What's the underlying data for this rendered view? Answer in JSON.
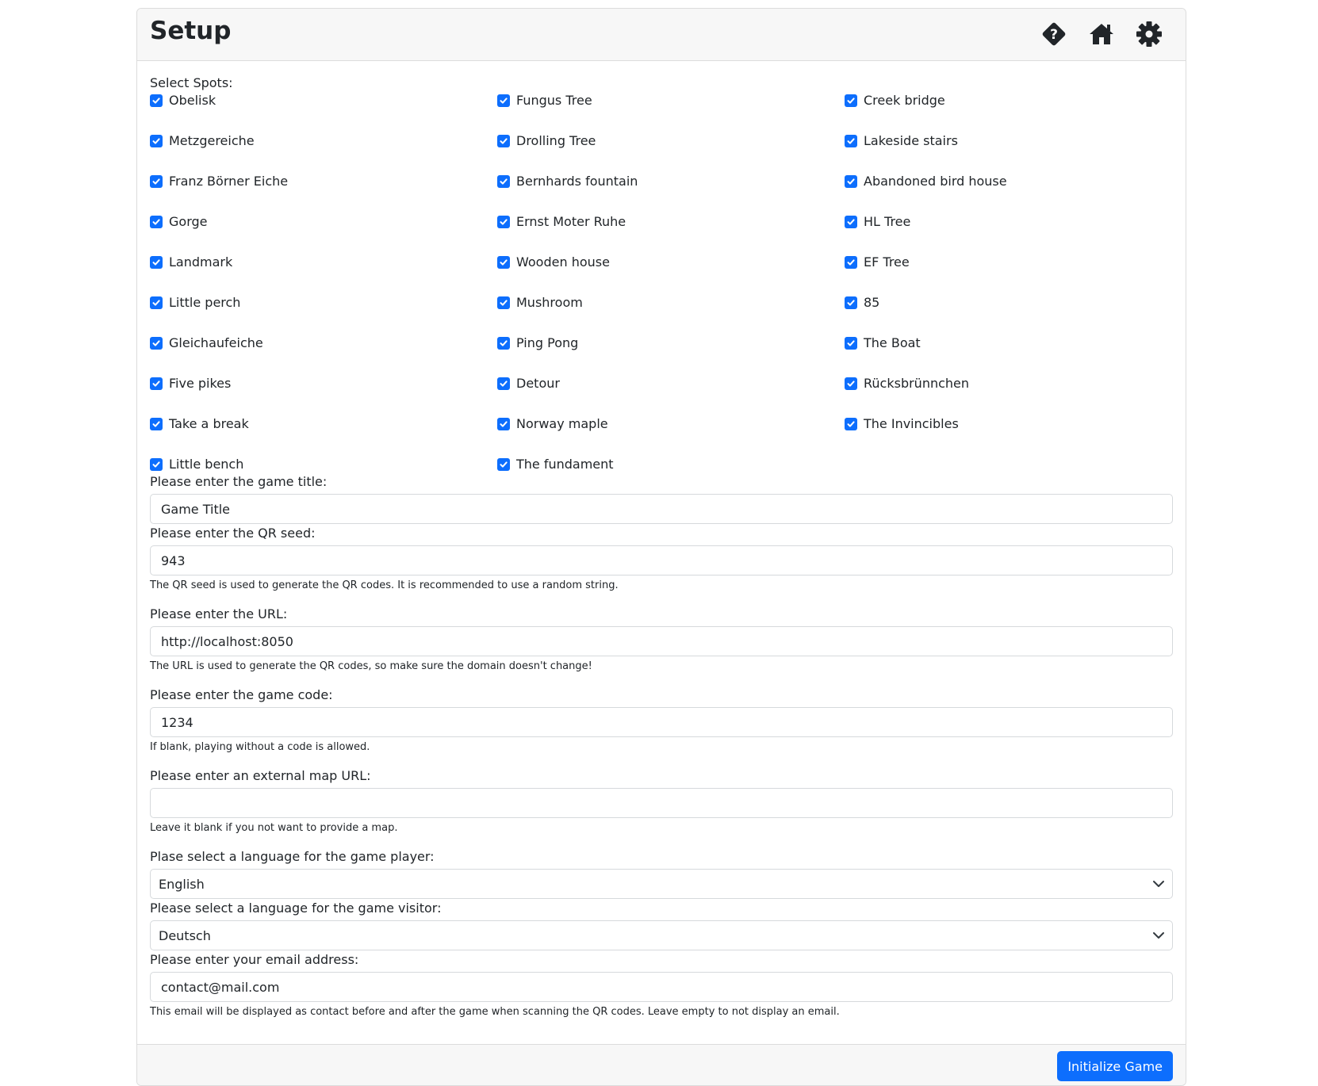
{
  "header": {
    "title": "Setup",
    "icons": [
      "question-diamond-icon",
      "home-icon",
      "gear-icon"
    ]
  },
  "spots": {
    "label": "Select Spots:",
    "items": [
      {
        "label": "Obelisk",
        "checked": true
      },
      {
        "label": "Fungus Tree",
        "checked": true
      },
      {
        "label": "Creek bridge",
        "checked": true
      },
      {
        "label": "Metzgereiche",
        "checked": true
      },
      {
        "label": "Drolling Tree",
        "checked": true
      },
      {
        "label": "Lakeside stairs",
        "checked": true
      },
      {
        "label": "Franz Börner Eiche",
        "checked": true
      },
      {
        "label": "Bernhards fountain",
        "checked": true
      },
      {
        "label": "Abandoned bird house",
        "checked": true
      },
      {
        "label": "Gorge",
        "checked": true
      },
      {
        "label": "Ernst Moter Ruhe",
        "checked": true
      },
      {
        "label": "HL Tree",
        "checked": true
      },
      {
        "label": "Landmark",
        "checked": true
      },
      {
        "label": "Wooden house",
        "checked": true
      },
      {
        "label": "EF Tree",
        "checked": true
      },
      {
        "label": "Little perch",
        "checked": true
      },
      {
        "label": "Mushroom",
        "checked": true
      },
      {
        "label": "85",
        "checked": true
      },
      {
        "label": "Gleichaufeiche",
        "checked": true
      },
      {
        "label": "Ping Pong",
        "checked": true
      },
      {
        "label": "The Boat",
        "checked": true
      },
      {
        "label": "Five pikes",
        "checked": true
      },
      {
        "label": "Detour",
        "checked": true
      },
      {
        "label": "Rücksbrünnchen",
        "checked": true
      },
      {
        "label": "Take a break",
        "checked": true
      },
      {
        "label": "Norway maple",
        "checked": true
      },
      {
        "label": "The Invincibles",
        "checked": true
      },
      {
        "label": "Little bench",
        "checked": true
      },
      {
        "label": "The fundament",
        "checked": true
      }
    ]
  },
  "form": {
    "game_title": {
      "label": "Please enter the game title:",
      "value": "Game Title"
    },
    "qr_seed": {
      "label": "Please enter the QR seed:",
      "value": "943",
      "help": "The QR seed is used to generate the QR codes. It is recommended to use a random string."
    },
    "url": {
      "label": "Please enter the URL:",
      "value": "http://localhost:8050",
      "help": "The URL is used to generate the QR codes, so make sure the domain doesn't change!"
    },
    "game_code": {
      "label": "Please enter the game code:",
      "value": "1234",
      "help": "If blank, playing without a code is allowed."
    },
    "map_url": {
      "label": "Please enter an external map URL:",
      "value": "",
      "help": "Leave it blank if you not want to provide a map."
    },
    "player_language": {
      "label": "Plase select a language for the game player:",
      "value": "English"
    },
    "visitor_language": {
      "label": "Please select a language for the game visitor:",
      "value": "Deutsch"
    },
    "email": {
      "label": "Please enter your email address:",
      "value": "contact@mail.com",
      "help": "This email will be displayed as contact before and after the game when scanning the QR codes. Leave empty to not display an email."
    }
  },
  "footer": {
    "submit_label": "Initialize Game"
  },
  "colors": {
    "accent": "#0d6efd",
    "header_bg": "#f7f7f7"
  }
}
